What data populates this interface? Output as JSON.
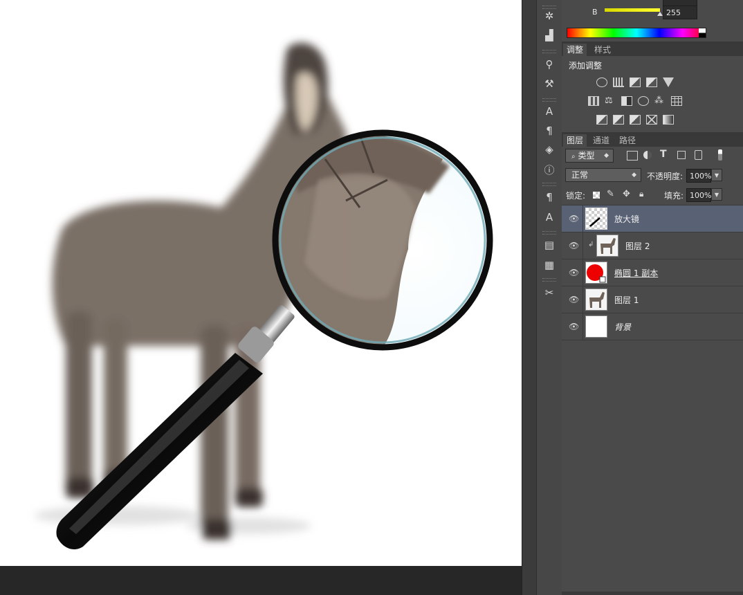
{
  "color_panel": {
    "channel_label": "B",
    "channel_value": "255",
    "slider_value_fraction": 1.0
  },
  "adjustments": {
    "tabs": [
      "调整",
      "样式"
    ],
    "header": "添加调整",
    "icon_rows": [
      [
        "brightness-contrast-icon",
        "levels-icon",
        "curves-icon",
        "exposure-icon",
        "vibrance-icon"
      ],
      [
        "hue-saturation-icon",
        "color-balance-icon",
        "black-white-icon",
        "photo-filter-icon",
        "channel-mixer-icon",
        "color-lookup-icon"
      ],
      [
        "invert-icon",
        "posterize-icon",
        "threshold-icon",
        "selective-color-icon",
        "gradient-map-icon"
      ]
    ]
  },
  "layers_panel": {
    "tabs": [
      "图层",
      "通道",
      "路径"
    ],
    "filter_kind": "类型",
    "blend_mode": "正常",
    "opacity_label": "不透明度:",
    "opacity_value": "100%",
    "lock_label": "锁定:",
    "fill_label": "填充:",
    "fill_value": "100%",
    "layers": [
      {
        "name": "放大镜",
        "selected": true,
        "thumb": "transparent-pen"
      },
      {
        "name": "图层 2",
        "selected": false,
        "thumb": "donkey",
        "clipped": true
      },
      {
        "name": "椭圆 1 副本",
        "selected": false,
        "thumb": "red-ellipse"
      },
      {
        "name": "图层 1",
        "selected": false,
        "thumb": "donkey"
      },
      {
        "name": "背景",
        "selected": false,
        "thumb": "white"
      }
    ]
  },
  "tools": [
    "navigator-icon",
    "histogram-icon",
    "brush-presets-icon",
    "tool-presets-icon",
    "character-icon",
    "paragraph-icon",
    "3d-icon",
    "info-icon",
    "paragraph-styles-icon",
    "character-styles-icon",
    "layer-comps-icon",
    "notes-icon",
    "tool-settings-icon"
  ],
  "colors": {
    "canvas_bg": "#ffffff",
    "panel_bg": "#4a4a4a",
    "selected_layer": "#596174",
    "ellipse_red": "#ee0000"
  }
}
